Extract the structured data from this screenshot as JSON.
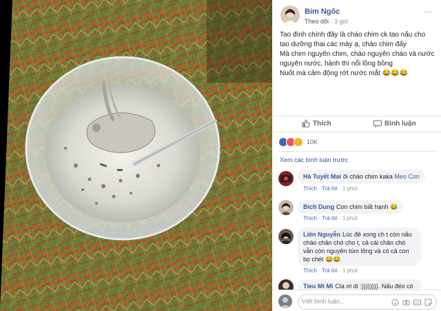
{
  "post": {
    "author": "Bim Ngốc",
    "follow_label": "Theo dõi",
    "time": "3 giờ",
    "more_icon": "ellipsis-icon",
    "caption_lines": [
      "Tao đính chính đây là cháo chim ck tao nấu cho tao dưỡng thai các mày ạ, cháo chim đấy",
      "Mà chim nguyên chim, cháo nguyên cháo và nước nguyên nước, hành thì nổi lồng bồng",
      "Nuốt mà cảm động rớt nước mắt 😂😂😂"
    ]
  },
  "actions": {
    "like_label": "Thích",
    "comment_label": "Bình luận"
  },
  "reactions": {
    "count": "10K",
    "types": [
      "like",
      "love",
      "haha"
    ]
  },
  "comments": {
    "view_previous": "Xem các bình luận trước",
    "items": [
      {
        "name": "Hà Tuyết Mai",
        "text": "ôi cháo chim kaka",
        "tag": "Meo Con",
        "like": "Thích",
        "reply": "Trả lời",
        "time": "1 phút"
      },
      {
        "name": "Bich Dung",
        "text": "Con chim bất hạnh 😂",
        "like": "Thích",
        "reply": "Trả lời",
        "time": "1 phút"
      },
      {
        "name": "Liên Nguyễn",
        "text": "Lúc đẻ xong ch t còn nấu cháo chân chó cho t, cả cái chân chó vẫn còn nguyên túm lông và có cả con bọ chét 😂😂",
        "like": "Thích",
        "reply": "Trả lời",
        "time": "1 phút"
      },
      {
        "name": "Tieu Mi Mi",
        "text": "Cla ơi di :)))))))). Nấu đéo có"
      }
    ]
  },
  "composer": {
    "placeholder": "Viết bình luận..."
  },
  "colors": {
    "link": "#365899",
    "like_blue": "#4267b2",
    "love_red": "#f25268",
    "haha_yellow": "#f7b125"
  }
}
